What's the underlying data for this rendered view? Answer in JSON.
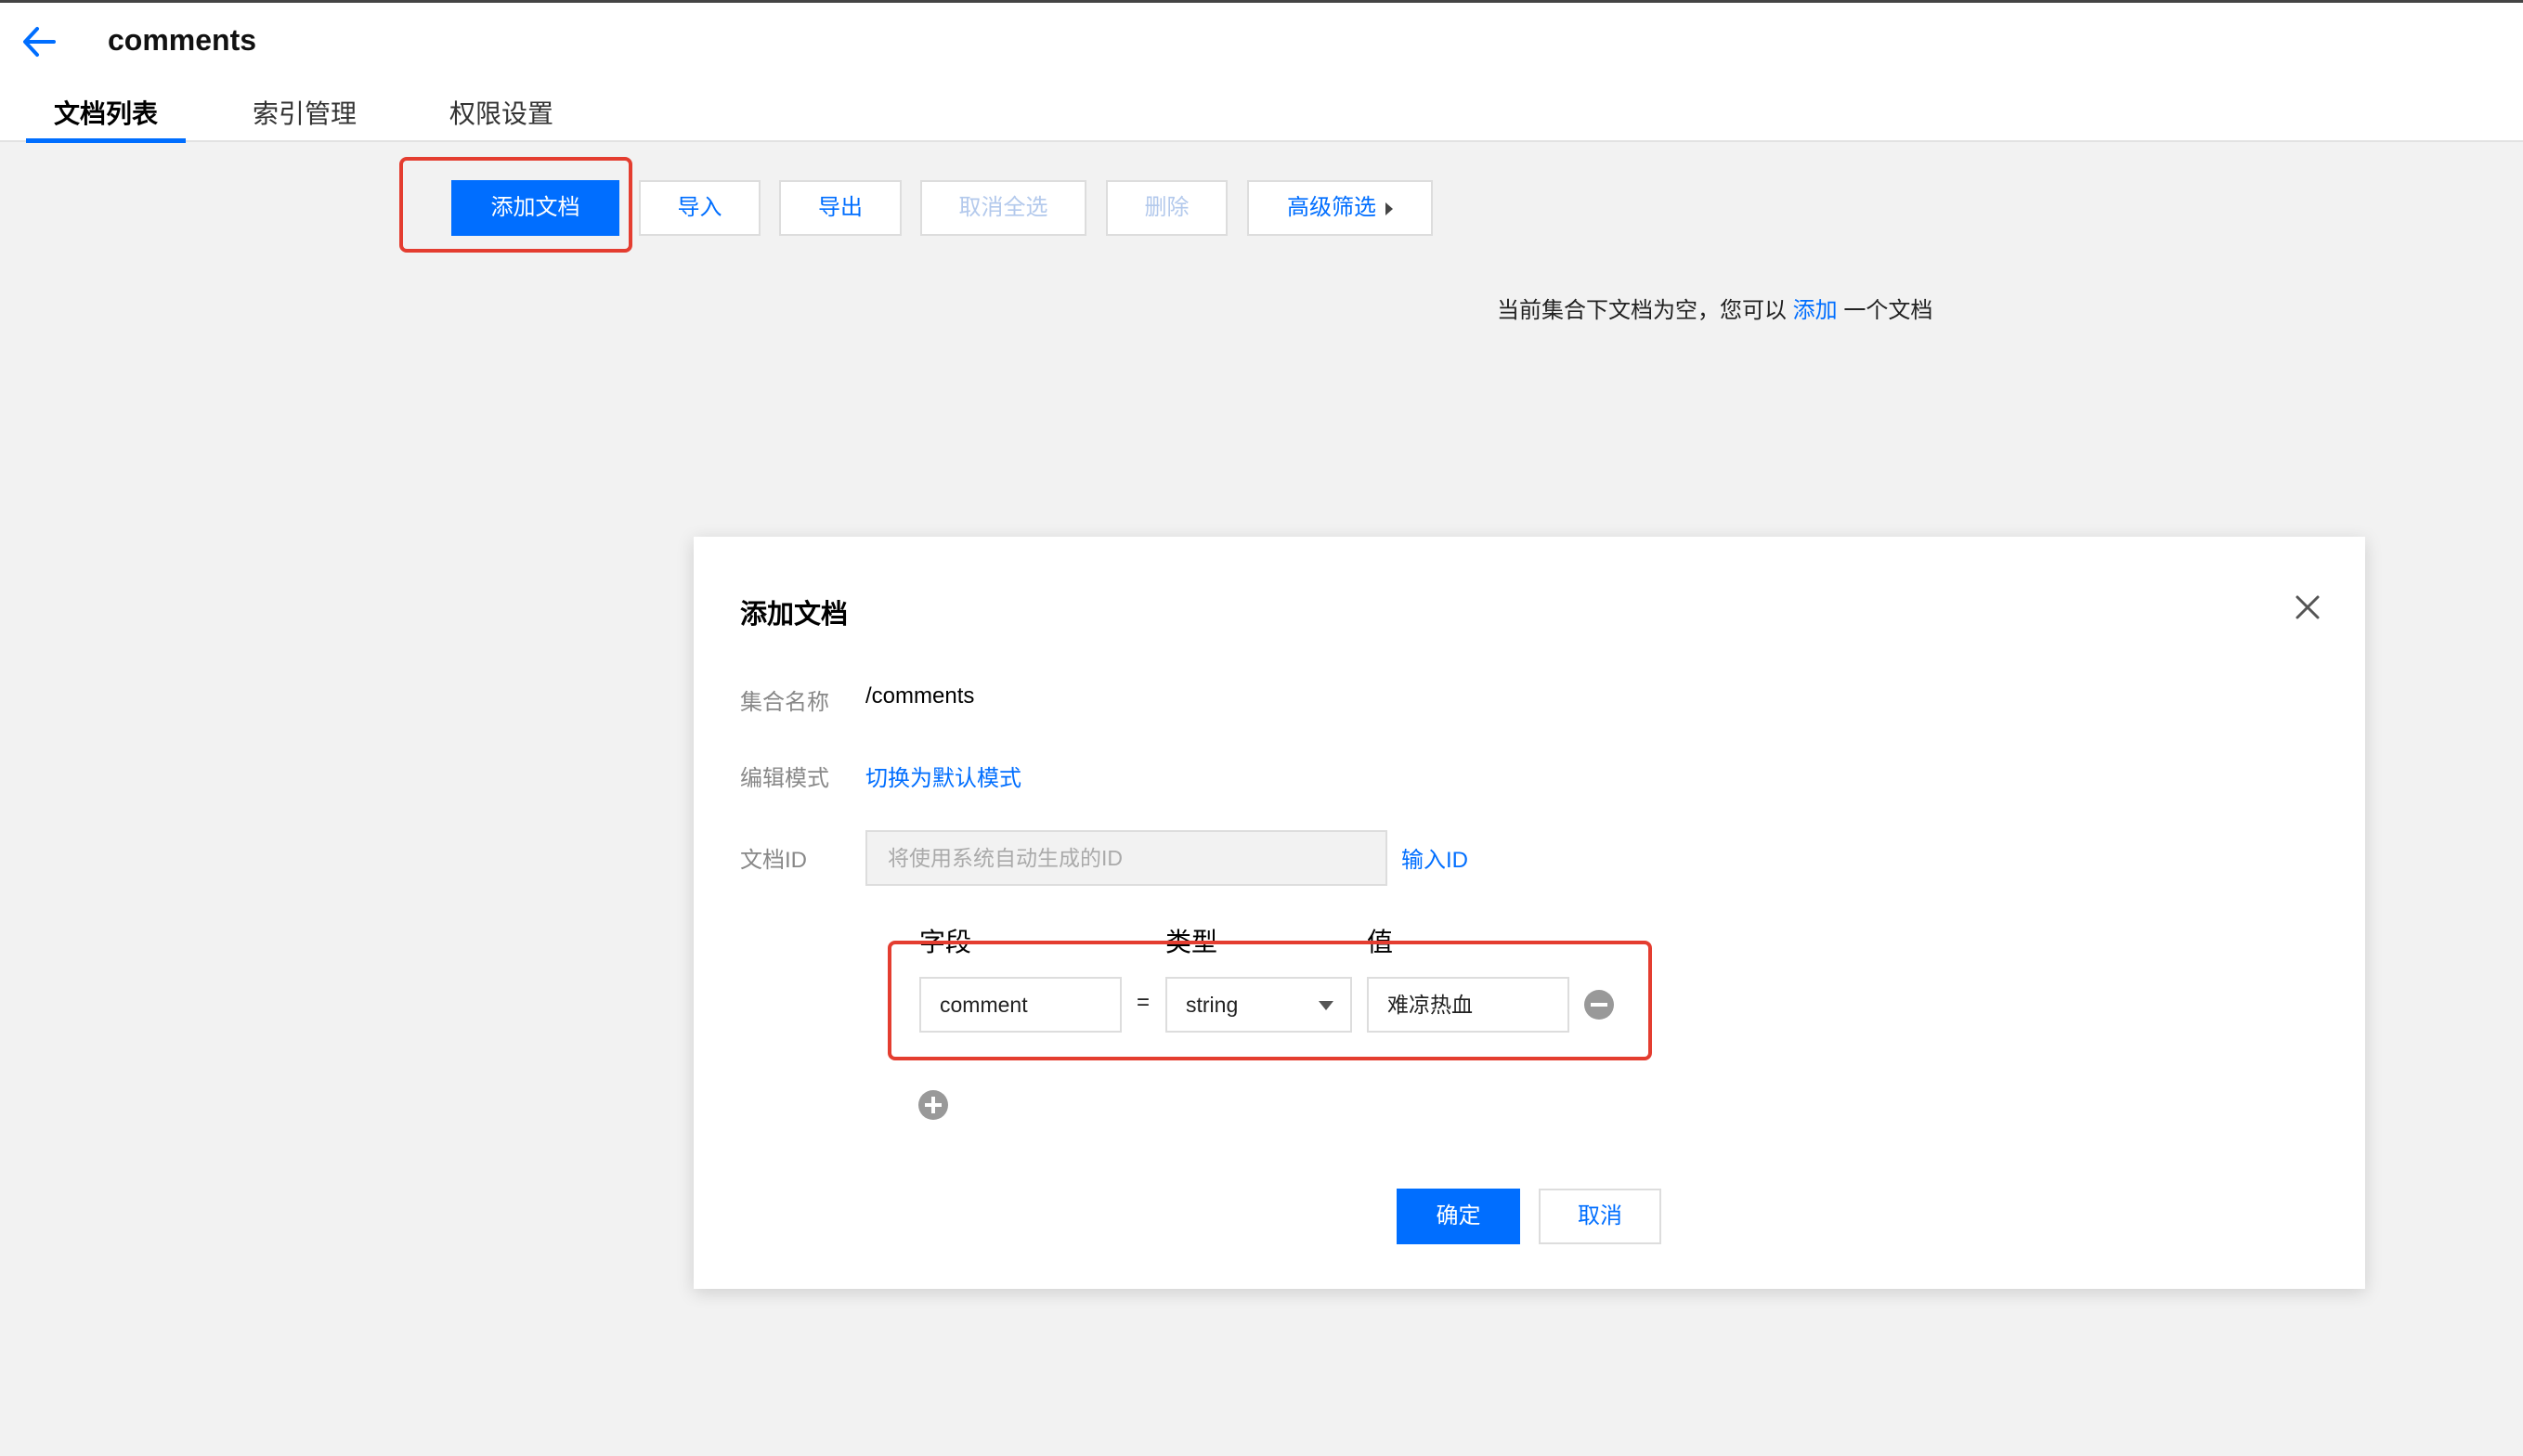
{
  "header": {
    "title": "comments",
    "tabs": [
      {
        "label": "文档列表",
        "active": true
      },
      {
        "label": "索引管理",
        "active": false
      },
      {
        "label": "权限设置",
        "active": false
      }
    ]
  },
  "toolbar": {
    "add_document": "添加文档",
    "import": "导入",
    "export": "导出",
    "deselect_all": "取消全选",
    "delete": "删除",
    "advanced_filter": "高级筛选"
  },
  "empty_state": {
    "prefix": "当前集合下文档为空，您可以 ",
    "link": "添加",
    "suffix": " 一个文档"
  },
  "modal": {
    "title": "添加文档",
    "collection_label": "集合名称",
    "collection_value": "/comments",
    "edit_mode_label": "编辑模式",
    "edit_mode_link": "切换为默认模式",
    "doc_id_label": "文档ID",
    "doc_id_placeholder": "将使用系统自动生成的ID",
    "enter_id_link": "输入ID",
    "columns": {
      "field": "字段",
      "type": "类型",
      "value": "值"
    },
    "row": {
      "field": "comment",
      "equals": "=",
      "type": "string",
      "value": "难凉热血"
    },
    "confirm": "确定",
    "cancel": "取消"
  },
  "colors": {
    "primary": "#006eff",
    "highlight": "#e43d30"
  },
  "icons": [
    "back-arrow-icon",
    "close-icon",
    "minus-circle-icon",
    "plus-circle-icon",
    "caret-right-icon",
    "caret-down-icon"
  ]
}
